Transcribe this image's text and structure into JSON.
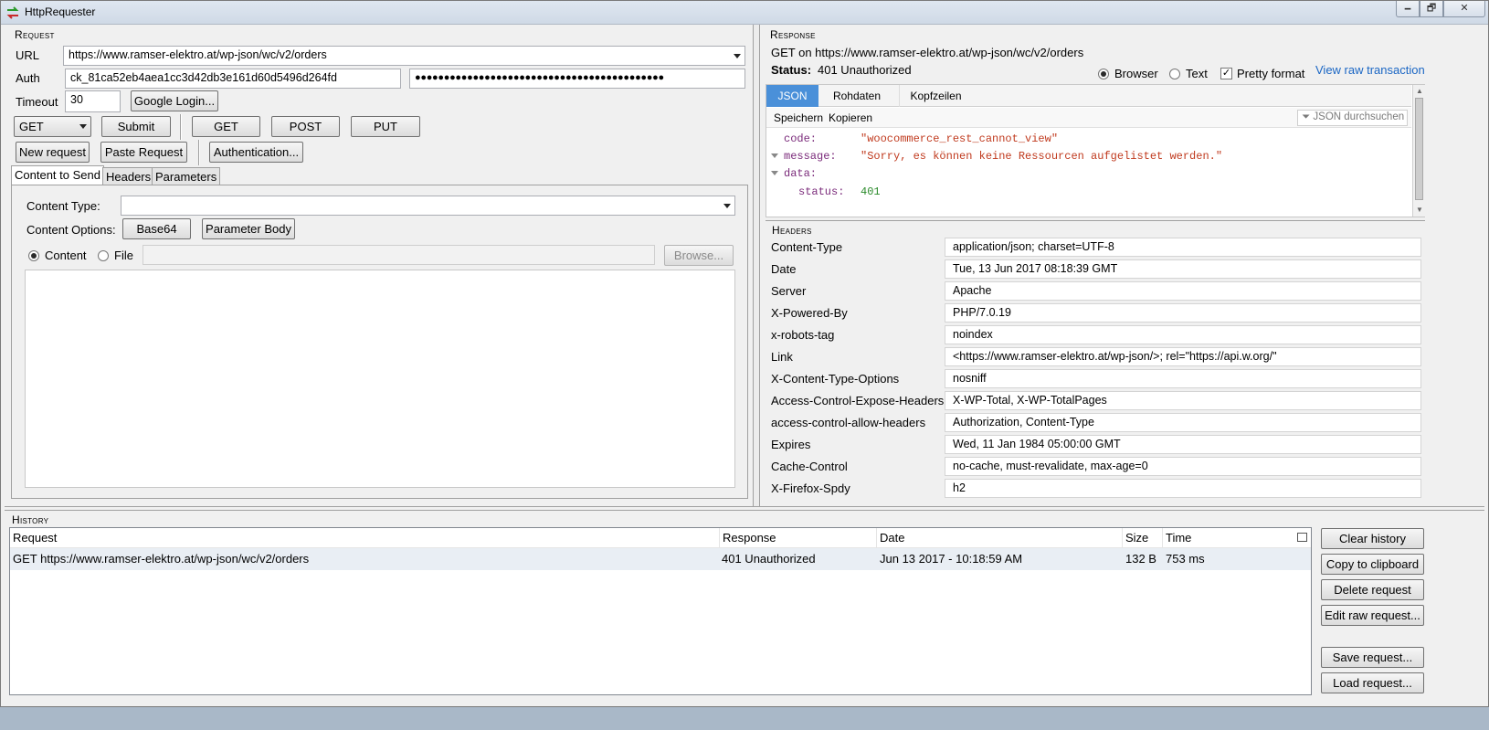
{
  "window": {
    "title": "HttpRequester",
    "min": "🗕",
    "max": "🗗",
    "close": "✕"
  },
  "request": {
    "section_title": "Request",
    "url_label": "URL",
    "url_value": "https://www.ramser-elektro.at/wp-json/wc/v2/orders",
    "auth_label": "Auth",
    "auth_user": "ck_81ca52eb4aea1cc3d42db3e161d60d5496d264fd",
    "auth_password": "●●●●●●●●●●●●●●●●●●●●●●●●●●●●●●●●●●●●●●●●●●●",
    "timeout_label": "Timeout",
    "timeout_value": "30",
    "google_login": "Google Login...",
    "method": "GET",
    "submit": "Submit",
    "get": "GET",
    "post": "POST",
    "put": "PUT",
    "new_request": "New request",
    "paste_request": "Paste Request",
    "authentication": "Authentication...",
    "tabs": [
      "Content to Send",
      "Headers",
      "Parameters"
    ],
    "content_type_label": "Content Type:",
    "content_type_value": "",
    "content_options_label": "Content Options:",
    "base64": "Base64",
    "parameter_body": "Parameter Body",
    "content_radio": "Content",
    "file_radio": "File",
    "file_path": "",
    "browse": "Browse..."
  },
  "response": {
    "section_title": "Response",
    "request_line": "GET on https://www.ramser-elektro.at/wp-json/wc/v2/orders",
    "status_label": "Status:",
    "status_value": "401 Unauthorized",
    "view_browser": "Browser",
    "view_text": "Text",
    "pretty_format": "Pretty format",
    "view_raw": "View raw transaction",
    "tabs": [
      "JSON",
      "Rohdaten",
      "Kopfzeilen"
    ],
    "save": "Speichern",
    "copy": "Kopieren",
    "filter": "JSON durchsuchen",
    "json": {
      "code_key": "code:",
      "code_val": "\"woocommerce_rest_cannot_view\"",
      "message_key": "message:",
      "message_val": "\"Sorry, es können keine Ressourcen aufgelistet werden.\"",
      "data_key": "data:",
      "status_key": "status:",
      "status_val": "401"
    }
  },
  "headers": {
    "section_title": "Headers",
    "rows": [
      {
        "name": "Content-Type",
        "value": "application/json; charset=UTF-8"
      },
      {
        "name": "Date",
        "value": "Tue, 13 Jun 2017 08:18:39 GMT"
      },
      {
        "name": "Server",
        "value": "Apache"
      },
      {
        "name": "X-Powered-By",
        "value": "PHP/7.0.19"
      },
      {
        "name": "x-robots-tag",
        "value": "noindex"
      },
      {
        "name": "Link",
        "value": "<https://www.ramser-elektro.at/wp-json/>; rel=\"https://api.w.org/\""
      },
      {
        "name": "X-Content-Type-Options",
        "value": "nosniff"
      },
      {
        "name": "Access-Control-Expose-Headers",
        "value": "X-WP-Total, X-WP-TotalPages"
      },
      {
        "name": "access-control-allow-headers",
        "value": "Authorization, Content-Type"
      },
      {
        "name": "Expires",
        "value": "Wed, 11 Jan 1984 05:00:00 GMT"
      },
      {
        "name": "Cache-Control",
        "value": "no-cache, must-revalidate, max-age=0"
      },
      {
        "name": "X-Firefox-Spdy",
        "value": "h2"
      }
    ]
  },
  "history": {
    "section_title": "History",
    "columns": [
      "Request",
      "Response",
      "Date",
      "Size",
      "Time"
    ],
    "rows": [
      {
        "request": "GET https://www.ramser-elektro.at/wp-json/wc/v2/orders",
        "response": "401 Unauthorized",
        "date": "Jun 13 2017 - 10:18:59 AM",
        "size": "132 B",
        "time": "753 ms"
      }
    ],
    "clear": "Clear history",
    "copy": "Copy to clipboard",
    "delete": "Delete request",
    "edit_raw": "Edit raw request...",
    "save": "Save request...",
    "load": "Load request..."
  }
}
